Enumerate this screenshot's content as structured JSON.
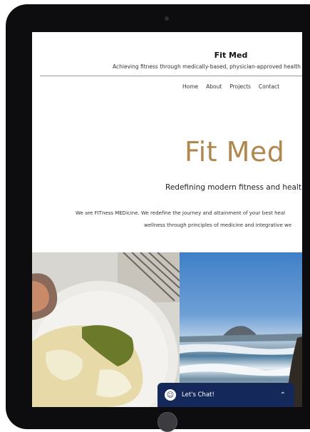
{
  "site": {
    "title": "Fit Med",
    "tagline": "Achieving fitness through medically-based, physician-approved health"
  },
  "nav": {
    "items": [
      {
        "label": "Home"
      },
      {
        "label": "About"
      },
      {
        "label": "Projects"
      },
      {
        "label": "Contact"
      }
    ]
  },
  "hero": {
    "title": "Fit Med",
    "subtitle": "Redefining modern fitness and health",
    "intro_line1": "We are FITness MEDicine.  We redefine the journey and attainment of your best heal",
    "intro_line2": "wellness through principles of medicine and integrative we"
  },
  "chat": {
    "label": "Let's Chat!",
    "icon": "smiley-icon",
    "chevron": "chevron-up-icon"
  },
  "colors": {
    "hero_title": "#b0874f",
    "chat_background": "#14295a",
    "device_bezel": "#0d0d0f"
  }
}
